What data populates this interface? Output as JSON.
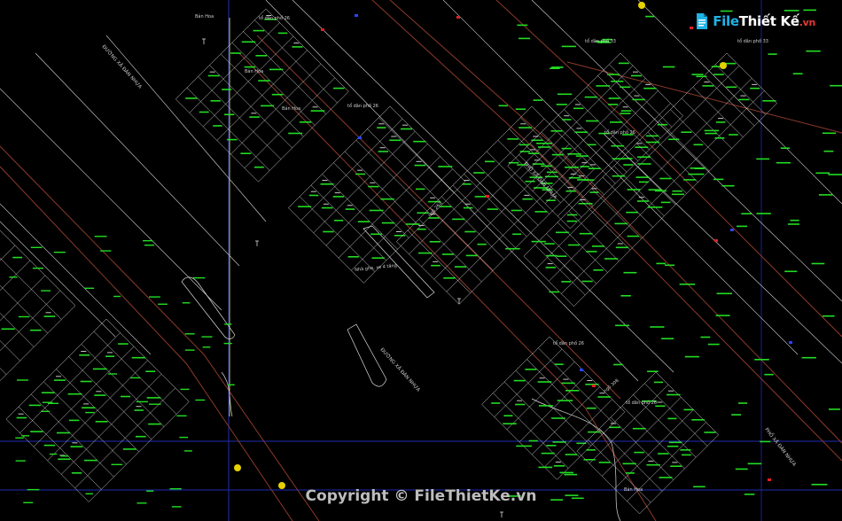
{
  "brand": {
    "logo_text_part1": "File",
    "logo_text_part2": "Thiết Kế",
    "logo_text_part3": ".vn",
    "colors": {
      "cyan": "#1fb3e6",
      "white": "#ffffff",
      "red": "#e53935"
    }
  },
  "copyright": "Copyright © FileThietKe.vn",
  "map": {
    "colors": {
      "background": "#000000",
      "parcel_line": "#d9d9d9",
      "road_line": "#8b3a2a",
      "grid_blue": "#1f2bb3",
      "grid_yellow": "#c9c04a",
      "label_green": "#22dd22",
      "marker_red": "#e02020",
      "marker_blue": "#2a44ff"
    },
    "labels": {
      "road_main_upper": "ĐƯỜNG XÃ ĐÀN NHỰA",
      "road_main_lower": "ĐƯỜNG XÃ ĐÀN NHỰA",
      "street_diagonal": "PHỐ XÃ ĐÀN NHỰA",
      "street_right": "PHỐ XÃ ĐÀN NHỰA",
      "building": "Nhà ghe, xe 4 tầng",
      "group_26_a": "tổ dân phố 26",
      "group_26_b": "tổ dân phố 26",
      "group_26_c": "tổ dân phố 26",
      "group_26_d": "tổ dân phố 26",
      "group_26_e": "tổ dân phố 26",
      "group_33_a": "tổ dân phố 33",
      "group_33_b": "tổ dân phố 33",
      "ban_hoa_1": "Bản Hoa",
      "ban_hoa_2": "Bản Hoa",
      "ban_hoa_3": "Bản Hoa",
      "ban_hoa_4": "Bản Hoa",
      "ngo_1": "ngõ 262",
      "ngo_2": "ngõ 308"
    }
  }
}
